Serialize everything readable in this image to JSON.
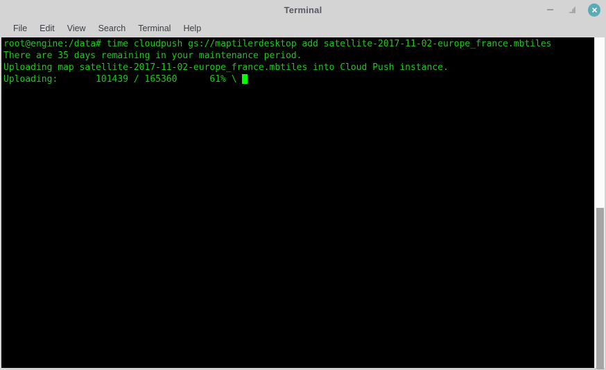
{
  "window": {
    "title": "Terminal",
    "controls": {
      "minimize_label": "–",
      "maximize_label": "⬜",
      "close_label": "×"
    }
  },
  "menubar": {
    "items": [
      {
        "label": "File"
      },
      {
        "label": "Edit"
      },
      {
        "label": "View"
      },
      {
        "label": "Search"
      },
      {
        "label": "Terminal"
      },
      {
        "label": "Help"
      }
    ]
  },
  "terminal": {
    "prompt": "root@engine:/data#",
    "command": "time cloudpush gs://maptilerdesktop add satellite-2017-11-02-europe_france.mbtiles",
    "lines": [
      "root@engine:/data# time cloudpush gs://maptilerdesktop add satellite-2017-11-02-europe_france.mbtiles",
      "There are 35 days remaining in your maintenance period.",
      "Uploading map satellite-2017-11-02-europe_france.mbtiles into Cloud Push instance.",
      "Uploading:       101439 / 165360      61% \\ "
    ],
    "upload": {
      "label": "Uploading:",
      "done": "101439",
      "separator": "/",
      "total": "165360",
      "percent": "61%",
      "spinner": "\\"
    },
    "maintenance_days": "35",
    "map_file": "satellite-2017-11-02-europe_france.mbtiles",
    "bucket": "gs://maptilerdesktop",
    "target": "Cloud Push instance",
    "colors": {
      "foreground": "#18cc18",
      "background": "#000000",
      "cursor": "#00ff00"
    }
  },
  "scrollbar": {
    "orientation": "vertical",
    "thumb_top_px": "246",
    "thumb_height_px": "233"
  }
}
